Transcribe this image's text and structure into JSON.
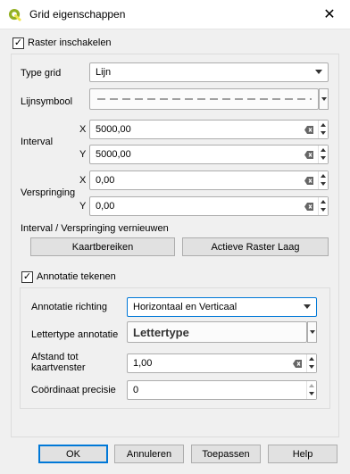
{
  "window": {
    "title": "Grid eigenschappen"
  },
  "raster_enable": {
    "label": "Raster inschakelen",
    "checked": true
  },
  "type_grid": {
    "label": "Type grid",
    "value": "Lijn"
  },
  "line_symbol": {
    "label": "Lijnsymbool"
  },
  "interval": {
    "label": "Interval",
    "x": {
      "axis": "X",
      "value": "5000,00"
    },
    "y": {
      "axis": "Y",
      "value": "5000,00"
    }
  },
  "offset": {
    "label": "Verspringing",
    "x": {
      "axis": "X",
      "value": "0,00"
    },
    "y": {
      "axis": "Y",
      "value": "0,00"
    }
  },
  "refresh": {
    "label": "Interval / Verspringing vernieuwen",
    "map_extent_button": "Kaartbereiken",
    "active_layer_button": "Actieve Raster Laag"
  },
  "annotation": {
    "label": "Annotatie tekenen",
    "checked": true,
    "direction": {
      "label": "Annotatie richting",
      "value": "Horizontaal en Verticaal"
    },
    "font": {
      "label": "Lettertype annotatie",
      "button": "Lettertype"
    },
    "distance": {
      "label_line1": "Afstand tot",
      "label_line2": "kaartvenster",
      "value": "1,00"
    },
    "precision": {
      "label": "Coördinaat precisie",
      "value": "0"
    }
  },
  "footer": {
    "ok": "OK",
    "cancel": "Annuleren",
    "apply": "Toepassen",
    "help": "Help"
  },
  "colors": {
    "accent": "#0078d7",
    "qgis_green": "#93b023"
  }
}
